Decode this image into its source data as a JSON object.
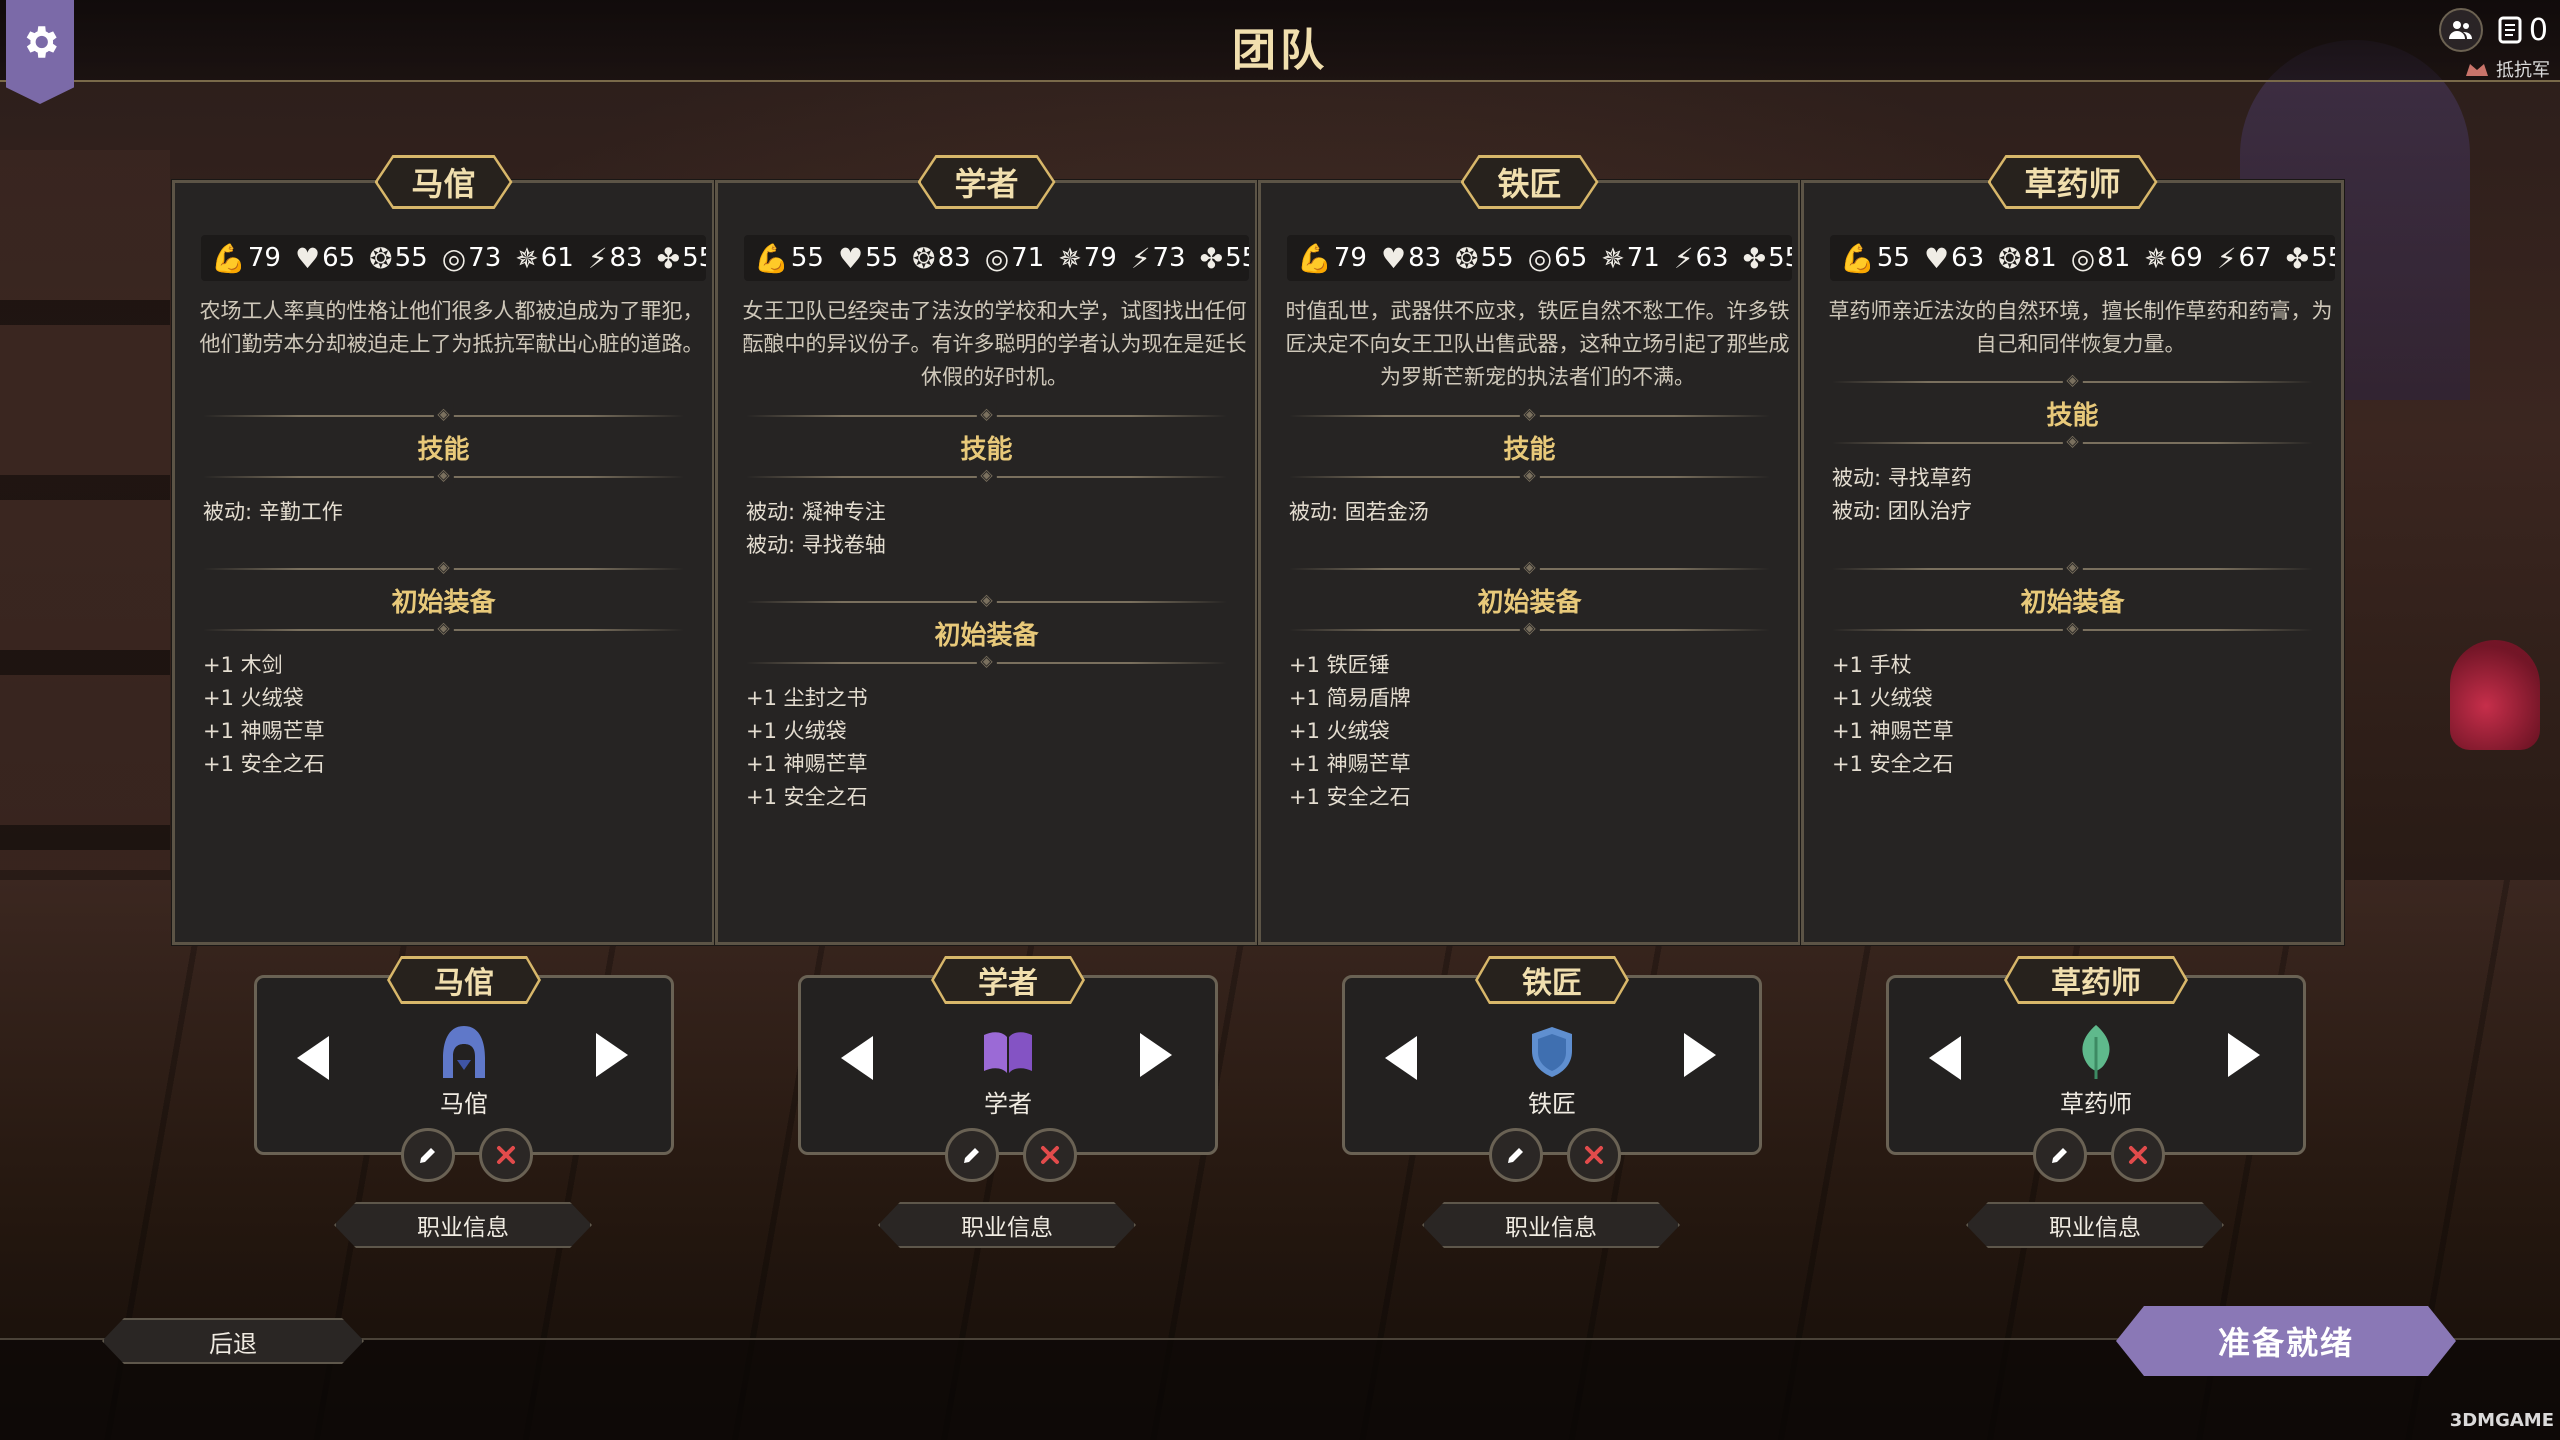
{
  "page": {
    "title": "团队"
  },
  "topbar": {
    "scroll_count": "0",
    "faction_label": "抵抗军"
  },
  "panels": [
    {
      "name": "马倌",
      "stats": [
        "79",
        "65",
        "55",
        "73",
        "61",
        "83",
        "55"
      ],
      "description": "农场工人率真的性格让他们很多人都被迫成为了罪犯，他们勤劳本分却被迫走上了为抵抗军献出心脏的道路。",
      "skills_title": "技能",
      "skills": [
        "被动: 辛勤工作"
      ],
      "equipment_title": "初始装备",
      "equipment": [
        "+1 木剑",
        "+1 火绒袋",
        "+1 神赐芒草",
        "+1 安全之石"
      ]
    },
    {
      "name": "学者",
      "stats": [
        "55",
        "55",
        "83",
        "71",
        "79",
        "73",
        "55"
      ],
      "description": "女王卫队已经突击了法汝的学校和大学，试图找出任何酝酿中的异议份子。有许多聪明的学者认为现在是延长休假的好时机。",
      "skills_title": "技能",
      "skills": [
        "被动: 凝神专注",
        "被动: 寻找卷轴"
      ],
      "equipment_title": "初始装备",
      "equipment": [
        "+1 尘封之书",
        "+1 火绒袋",
        "+1 神赐芒草",
        "+1 安全之石"
      ]
    },
    {
      "name": "铁匠",
      "stats": [
        "79",
        "83",
        "55",
        "65",
        "71",
        "63",
        "55"
      ],
      "description": "时值乱世，武器供不应求，铁匠自然不愁工作。许多铁匠决定不向女王卫队出售武器，这种立场引起了那些成为罗斯芒新宠的执法者们的不满。",
      "skills_title": "技能",
      "skills": [
        "被动: 固若金汤"
      ],
      "equipment_title": "初始装备",
      "equipment": [
        "+1 铁匠锤",
        "+1 简易盾牌",
        "+1 火绒袋",
        "+1 神赐芒草",
        "+1 安全之石"
      ]
    },
    {
      "name": "草药师",
      "stats": [
        "55",
        "63",
        "81",
        "81",
        "69",
        "67",
        "55"
      ],
      "description": "草药师亲近法汝的自然环境，擅长制作草药和药膏，为自己和同伴恢复力量。",
      "skills_title": "技能",
      "skills": [
        "被动: 寻找草药",
        "被动: 团队治疗"
      ],
      "equipment_title": "初始装备",
      "equipment": [
        "+1 手杖",
        "+1 火绒袋",
        "+1 神赐芒草",
        "+1 安全之石"
      ]
    }
  ],
  "stat_icons": [
    "strength-arm-icon",
    "heart-icon",
    "brain-icon",
    "eye-icon",
    "speed-icon",
    "agility-icon",
    "luck-icon"
  ],
  "selectors": [
    {
      "tab": "马倌",
      "name": "马倌",
      "icon": "hood-icon",
      "color": "#5f78c9",
      "info_label": "职业信息"
    },
    {
      "tab": "学者",
      "name": "学者",
      "icon": "book-icon",
      "color": "#9b6ad6",
      "info_label": "职业信息"
    },
    {
      "tab": "铁匠",
      "name": "铁匠",
      "icon": "shield-icon",
      "color": "#5f8fd0",
      "info_label": "职业信息"
    },
    {
      "tab": "草药师",
      "name": "草药师",
      "icon": "leaf-icon",
      "color": "#5fb98c",
      "info_label": "职业信息"
    }
  ],
  "footer": {
    "back_label": "后退",
    "ready_label": "准备就绪",
    "watermark": "3DMGAME"
  },
  "colors": {
    "accent_gold": "#d8b76a",
    "ready_purple": "#8a78b6",
    "remove_red": "#e24b4b"
  }
}
